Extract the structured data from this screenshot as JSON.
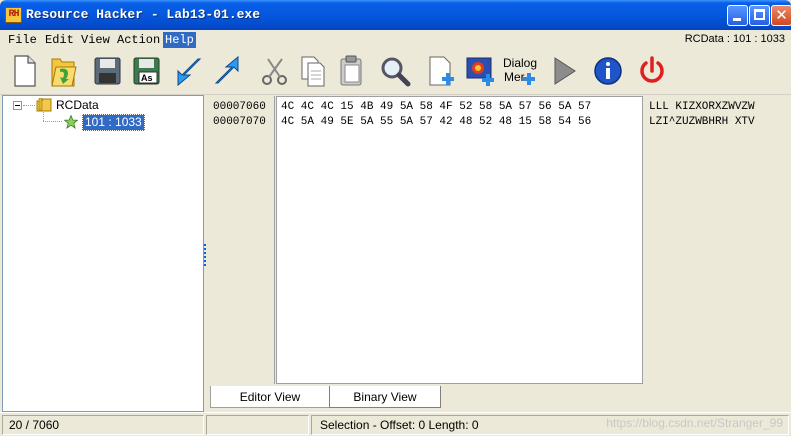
{
  "window": {
    "logo_text": "RH",
    "title": "Resource Hacker - Lab13-01.exe"
  },
  "menu": {
    "items": [
      "File",
      "Edit",
      "View",
      "Action",
      "Help"
    ],
    "active": "Help",
    "resource_info": "RCData : 101 : 1033"
  },
  "toolbar": {
    "buttons": [
      "new-file",
      "open-file",
      "save",
      "save-as",
      "back",
      "forward",
      "cut",
      "copy",
      "paste",
      "find",
      "add-resource",
      "add-image",
      "dialog-menu",
      "run-script",
      "about",
      "exit"
    ],
    "dialog_label_1": "Dialog",
    "dialog_label_2": "Mer"
  },
  "tree": {
    "root": "RCData",
    "child": "101 : 1033"
  },
  "editor": {
    "rows": [
      {
        "address": "00007060",
        "hex": "4C 4C 4C 15 4B 49 5A 58 4F 52 58 5A 57 56 5A 57",
        "ascii": "LLL KIZXORXZWVZW"
      },
      {
        "address": "00007070",
        "hex": "4C 5A 49 5E 5A 55 5A 57 42 48 52 48 15 58 54 56",
        "ascii": "LZI^ZUZWBHRH XTV"
      }
    ]
  },
  "tabs": {
    "editor_view": "Editor View",
    "binary_view": "Binary View"
  },
  "status": {
    "position": "20 / 7060",
    "empty": "",
    "selection": "Selection - Offset: 0 Length: 0",
    "watermark": "https://blog.csdn.net/Stranger_99"
  },
  "colors": {
    "title_blue": "#0558de",
    "selection_blue": "#316ac5",
    "window_bg": "#ece9d8"
  }
}
